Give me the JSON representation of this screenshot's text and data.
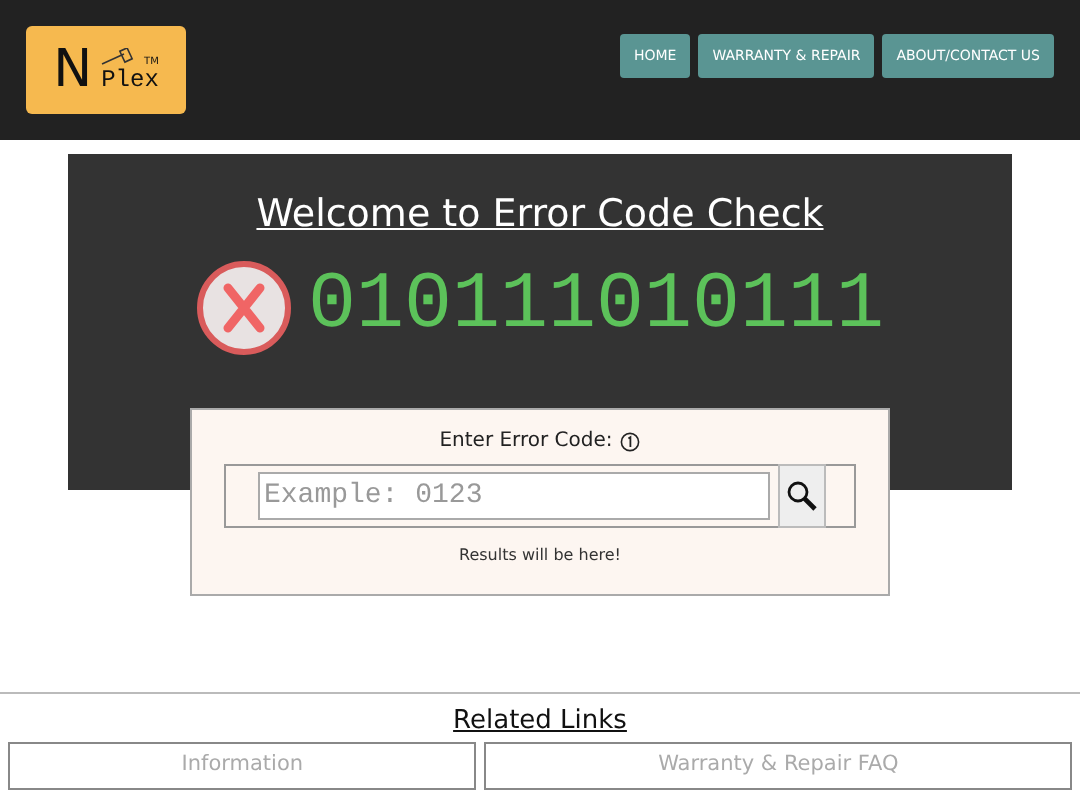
{
  "logo": {
    "letter": "N",
    "word": "Plex",
    "mark": "TM"
  },
  "nav": [
    {
      "label": "HOME"
    },
    {
      "label": "WARRANTY & REPAIR"
    },
    {
      "label": "ABOUT/CONTACT US"
    }
  ],
  "hero": {
    "title": "Welcome to Error Code Check",
    "code": "010111010111",
    "valid": false
  },
  "lookup": {
    "label": "Enter Error Code:",
    "placeholder": "Example: 0123",
    "result": "Results will be here!"
  },
  "related": {
    "title": "Related Links",
    "links": [
      {
        "label": "Information"
      },
      {
        "label": "Warranty & Repair FAQ"
      }
    ]
  }
}
